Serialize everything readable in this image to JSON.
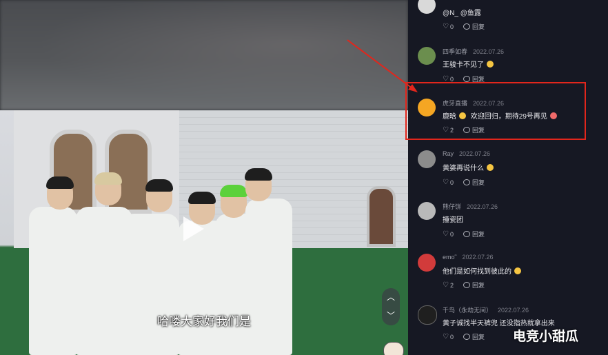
{
  "video": {
    "subtitle": "哈喽大家好我们是",
    "nav_up": "︿",
    "nav_down": "﹀"
  },
  "comments": [
    {
      "user": "@N_ @鱼露",
      "date": "",
      "text": "",
      "likes": "0",
      "reply": "回复",
      "avatar_color": "#d9d9d9",
      "header_only": true
    },
    {
      "user": "四季如春",
      "date": "2022.07.26",
      "text": "王骏卡不见了",
      "likes": "0",
      "reply": "回复",
      "avatar_color": "#6b8e4e",
      "emoji_color": "#f5c542"
    },
    {
      "user": "虎牙直播",
      "date": "2022.07.26",
      "text": "鹿晗",
      "text2": "欢迎回归，期待29号再见",
      "likes": "2",
      "reply": "回复",
      "avatar_color": "#f5a623",
      "emoji_color": "#f5c542",
      "emoji2_color": "#f06a6a"
    },
    {
      "user": "Ray",
      "date": "2022.07.26",
      "text": "黄婆再说什么",
      "likes": "0",
      "reply": "回复",
      "avatar_color": "#8c8c8c",
      "emoji_color": "#f5c542"
    },
    {
      "user": "熊仔饼",
      "date": "2022.07.26",
      "text": "撞瓷团",
      "likes": "0",
      "reply": "回复",
      "avatar_color": "#b9b9b9"
    },
    {
      "user": "emo˜",
      "date": "2022.07.26",
      "text": "他们是如何找到彼此的",
      "likes": "2",
      "reply": "回复",
      "avatar_color": "#d23b3b",
      "emoji_color": "#f5c542"
    },
    {
      "user": "千鸟（永劫无间）",
      "date": "2022.07.26",
      "text": "黄子诚找半天裤兜 还没指热就拿出来",
      "likes": "0",
      "reply": "回复",
      "avatar_color": "#1f1f1f"
    }
  ],
  "watermark": "电竞小甜瓜",
  "colors": {
    "highlight": "#e2261c",
    "panel_bg": "#161823",
    "text": "#e8e8ec"
  }
}
